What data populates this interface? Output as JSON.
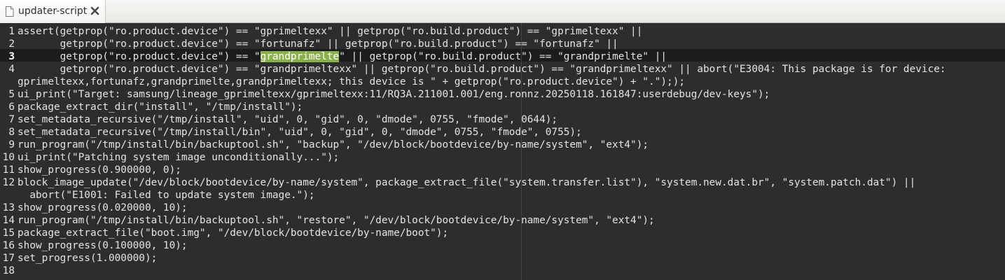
{
  "tab": {
    "title": "updater-script",
    "file_icon": "file-icon",
    "close_icon": "close-icon"
  },
  "editor": {
    "current_line": 3,
    "highlight_color": "#8ab04b",
    "lines": [
      {
        "number": "1",
        "text": "assert(getprop(\"ro.product.device\") == \"gprimeltexx\" || getprop(\"ro.build.product\") == \"gprimeltexx\" ||"
      },
      {
        "number": "2",
        "text": "       getprop(\"ro.product.device\") == \"fortunafz\" || getprop(\"ro.build.product\") == \"fortunafz\" ||"
      },
      {
        "number": "3",
        "pre": "       getprop(\"ro.product.device\") == \"",
        "match": "grandprimelte",
        "post": "\" || getprop(\"ro.build.product\") == \"grandprimelte\" ||"
      },
      {
        "number": "4",
        "text": "       getprop(\"ro.product.device\") == \"grandprimeltexx\" || getprop(\"ro.build.product\") == \"grandprimeltexx\" || abort(\"E3004: This package is for device:"
      },
      {
        "number": "",
        "text": "gprimeltexx,fortunafz,grandprimelte,grandprimeltexx; this device is \" + getprop(\"ro.product.device\") + \".\"););"
      },
      {
        "number": "5",
        "text": "ui_print(\"Target: samsung/lineage_gprimeltexx/gprimeltexx:11/RQ3A.211001.001/eng.ronnz.20250118.161847:userdebug/dev-keys\");"
      },
      {
        "number": "6",
        "text": "package_extract_dir(\"install\", \"/tmp/install\");"
      },
      {
        "number": "7",
        "text": "set_metadata_recursive(\"/tmp/install\", \"uid\", 0, \"gid\", 0, \"dmode\", 0755, \"fmode\", 0644);"
      },
      {
        "number": "8",
        "text": "set_metadata_recursive(\"/tmp/install/bin\", \"uid\", 0, \"gid\", 0, \"dmode\", 0755, \"fmode\", 0755);"
      },
      {
        "number": "9",
        "text": "run_program(\"/tmp/install/bin/backuptool.sh\", \"backup\", \"/dev/block/bootdevice/by-name/system\", \"ext4\");"
      },
      {
        "number": "10",
        "text": "ui_print(\"Patching system image unconditionally...\");"
      },
      {
        "number": "11",
        "text": "show_progress(0.900000, 0);"
      },
      {
        "number": "12",
        "text": "block_image_update(\"/dev/block/bootdevice/by-name/system\", package_extract_file(\"system.transfer.list\"), \"system.new.dat.br\", \"system.patch.dat\") ||"
      },
      {
        "number": "",
        "text": "  abort(\"E1001: Failed to update system image.\");"
      },
      {
        "number": "13",
        "text": "show_progress(0.020000, 10);"
      },
      {
        "number": "14",
        "text": "run_program(\"/tmp/install/bin/backuptool.sh\", \"restore\", \"/dev/block/bootdevice/by-name/system\", \"ext4\");"
      },
      {
        "number": "15",
        "text": "package_extract_file(\"boot.img\", \"/dev/block/bootdevice/by-name/boot\");"
      },
      {
        "number": "16",
        "text": "show_progress(0.100000, 10);"
      },
      {
        "number": "17",
        "text": "set_progress(1.000000);"
      },
      {
        "number": "18",
        "text": ""
      }
    ]
  }
}
